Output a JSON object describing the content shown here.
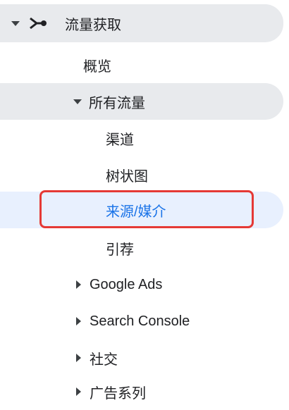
{
  "nav": {
    "acquisition": {
      "label": "流量获取",
      "icon": "acquisition-icon"
    },
    "overview": {
      "label": "概览"
    },
    "all_traffic": {
      "label": "所有流量"
    },
    "channels": {
      "label": "渠道"
    },
    "treemap": {
      "label": "树状图"
    },
    "source_medium": {
      "label": "来源/媒介"
    },
    "referrals": {
      "label": "引荐"
    },
    "google_ads": {
      "label": "Google Ads"
    },
    "search_console": {
      "label": "Search Console"
    },
    "social": {
      "label": "社交"
    },
    "campaigns": {
      "label": "广告系列"
    }
  },
  "colors": {
    "pill": "#e8eaed",
    "active_bg": "#e8f0fe",
    "active_text": "#1a73e8",
    "highlight": "#e53935"
  }
}
